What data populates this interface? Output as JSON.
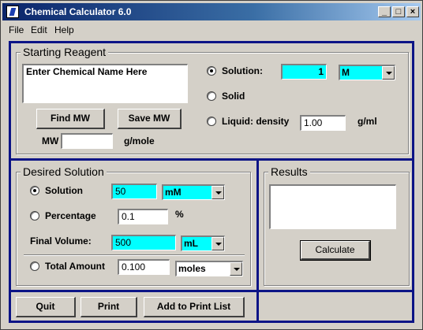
{
  "window": {
    "title": "Chemical Calculator 6.0"
  },
  "menu": {
    "file": "File",
    "edit": "Edit",
    "help": "Help"
  },
  "starting_reagent": {
    "legend": "Starting Reagent",
    "chemical_name_placeholder": "Enter Chemical Name Here",
    "find_mw": "Find MW",
    "save_mw": "Save MW",
    "mw_label": "MW",
    "mw_value": "",
    "mw_unit": "g/mole",
    "solution_label": "Solution:",
    "solution_value": "1",
    "solution_unit": "M",
    "solid_label": "Solid",
    "liquid_label": "Liquid: density",
    "density_value": "1.00",
    "density_unit": "g/ml",
    "selected": "solution"
  },
  "desired_solution": {
    "legend": "Desired Solution",
    "solution_label": "Solution",
    "solution_value": "50",
    "solution_unit": "mM",
    "percentage_label": "Percentage",
    "percentage_value": "0.1",
    "percentage_unit": "%",
    "final_volume_label": "Final Volume:",
    "final_volume_value": "500",
    "final_volume_unit": "mL",
    "total_amount_label": "Total Amount",
    "total_amount_value": "0.100",
    "total_amount_unit": "moles",
    "selected": "solution"
  },
  "results": {
    "legend": "Results",
    "output": "",
    "calculate": "Calculate"
  },
  "actions": {
    "quit": "Quit",
    "print": "Print",
    "add_to_print_list": "Add to Print List"
  },
  "colors": {
    "highlight_field": "#00ffff",
    "frame": "#0c1486",
    "titlebar": "#0a246a"
  }
}
